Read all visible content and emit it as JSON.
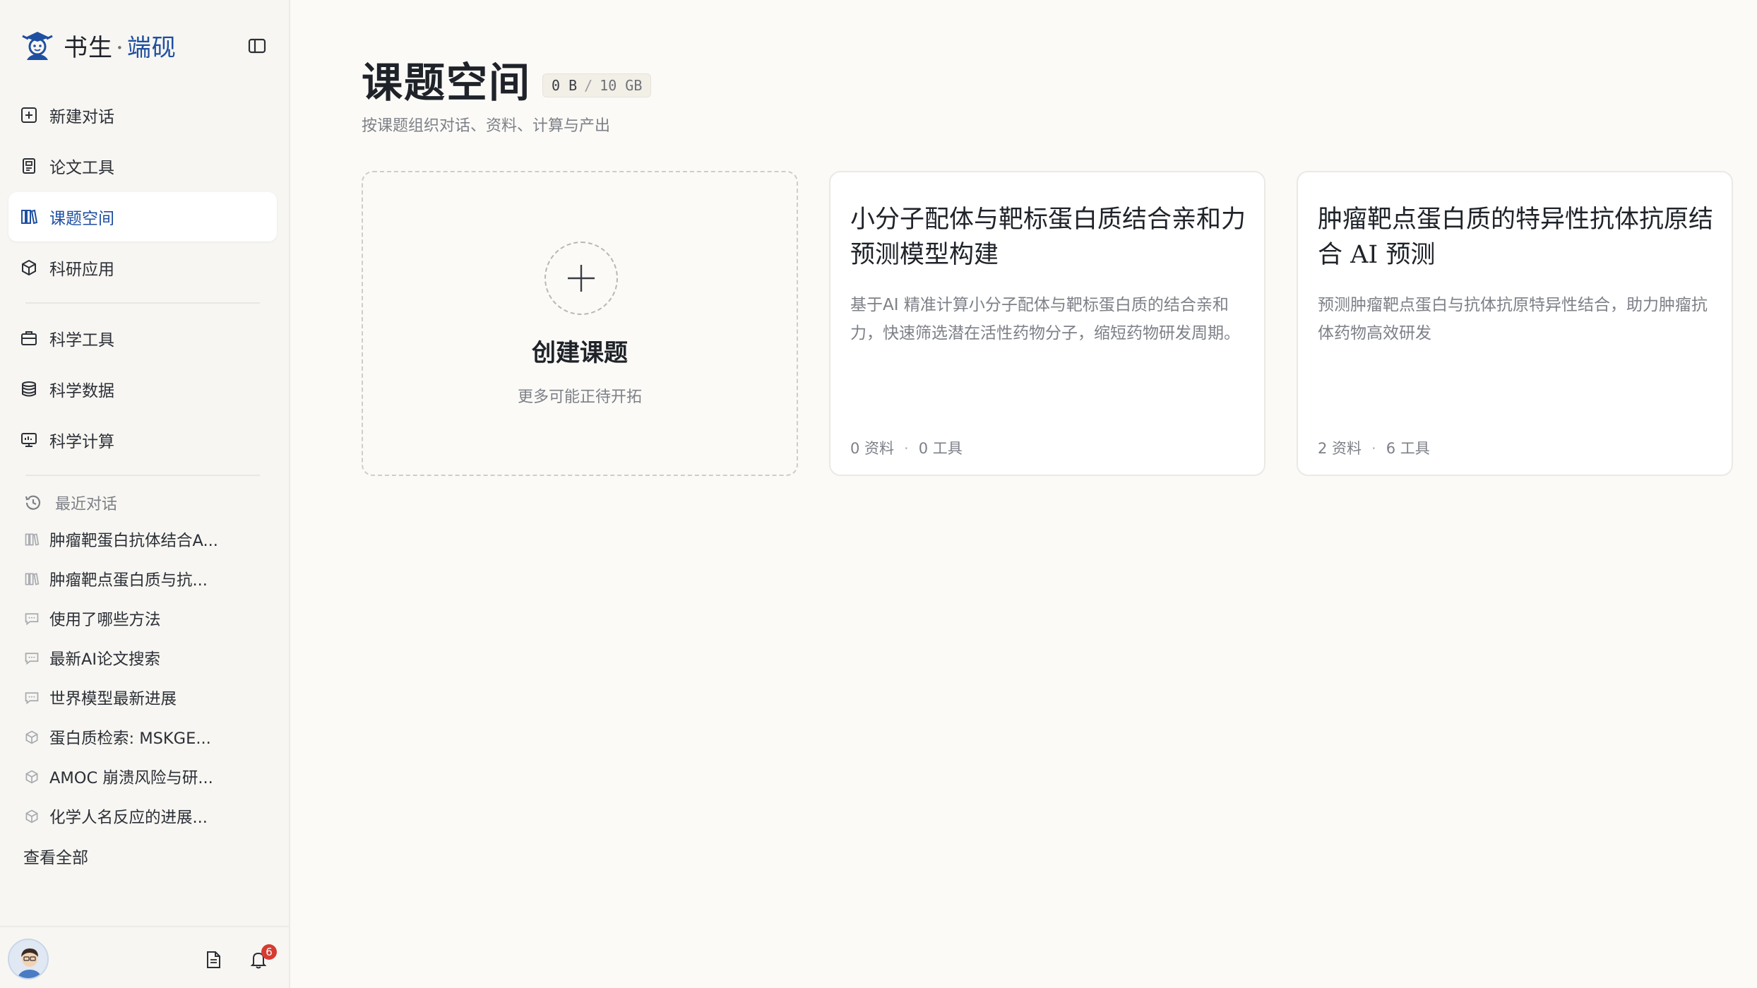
{
  "app": {
    "brand_main": "书生",
    "brand_sep": "·",
    "brand_accent": "端砚"
  },
  "sidebar": {
    "nav_primary": [
      {
        "label": "新建对话",
        "icon": "plus-square-icon"
      },
      {
        "label": "论文工具",
        "icon": "document-icon"
      },
      {
        "label": "课题空间",
        "icon": "books-icon",
        "active": true
      },
      {
        "label": "科研应用",
        "icon": "cube-icon"
      }
    ],
    "nav_secondary": [
      {
        "label": "科学工具",
        "icon": "toolbox-icon"
      },
      {
        "label": "科学数据",
        "icon": "database-icon"
      },
      {
        "label": "科学计算",
        "icon": "monitor-icon"
      }
    ],
    "recent_title": "最近对话",
    "recent_items": [
      {
        "label": "肿瘤靶蛋白抗体结合A...",
        "icon": "books-icon"
      },
      {
        "label": "肿瘤靶点蛋白质与抗...",
        "icon": "books-icon"
      },
      {
        "label": "使用了哪些方法",
        "icon": "chat-icon"
      },
      {
        "label": "最新AI论文搜索",
        "icon": "chat-icon"
      },
      {
        "label": "世界模型最新进展",
        "icon": "chat-icon"
      },
      {
        "label": "蛋白质检索: MSKGE...",
        "icon": "cube-icon"
      },
      {
        "label": "AMOC 崩溃风险与研...",
        "icon": "cube-icon"
      },
      {
        "label": "化学人名反应的进展...",
        "icon": "cube-icon"
      }
    ],
    "view_all": "查看全部",
    "notification_count": "6"
  },
  "main": {
    "title": "课题空间",
    "storage_used": "0 B",
    "storage_sep": "/",
    "storage_total": "10 GB",
    "subtitle": "按课题组织对话、资料、计算与产出",
    "create_card": {
      "title": "创建课题",
      "subtitle": "更多可能正待开拓"
    },
    "projects": [
      {
        "title": "小分子配体与靶标蛋白质结合亲和力预测模型构建",
        "description": "基于AI 精准计算小分子配体与靶标蛋白质的结合亲和力，快速筛选潜在活性药物分子，缩短药物研发周期。",
        "materials": "0 资料",
        "tools": "0 工具"
      },
      {
        "title": "肿瘤靶点蛋白质的特异性抗体抗原结合 AI 预测",
        "description": "预测肿瘤靶点蛋白与抗体抗原特异性结合，助力肿瘤抗体药物高效研发",
        "materials": "2 资料",
        "tools": "6 工具"
      }
    ],
    "meta_dot": "·"
  },
  "colors": {
    "accent": "#1f4fa0",
    "background": "#fbfaf7",
    "sidebar_bg": "#f7f6f2",
    "badge": "#d63b32"
  }
}
